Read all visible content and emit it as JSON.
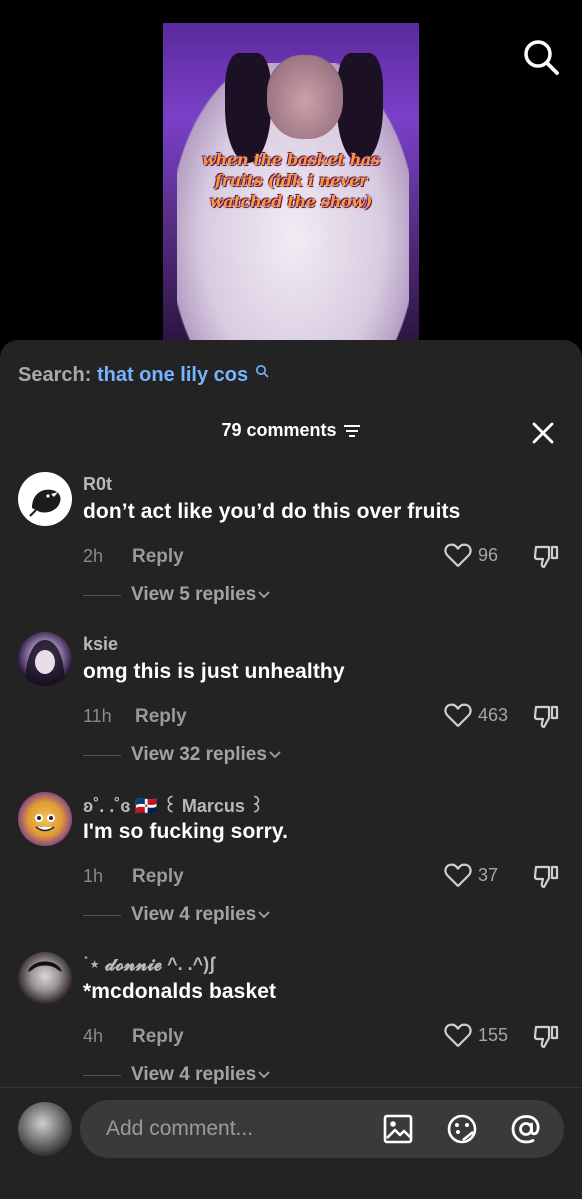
{
  "video": {
    "caption_lines": [
      "when the basket has",
      "fruits (idk i never",
      "watched the show)"
    ]
  },
  "search": {
    "label": "Search:",
    "query": "that one lily cos"
  },
  "comments_header": {
    "count_text": "79 comments"
  },
  "comments": [
    {
      "username": "R0t",
      "text": "don’t act like you’d do this over fruits",
      "time": "2h",
      "reply_label": "Reply",
      "likes": "96",
      "view_replies": "View 5 replies"
    },
    {
      "username": "ksie",
      "text": "omg this is just unhealthy",
      "time": "11h",
      "reply_label": "Reply",
      "likes": "463",
      "view_replies": "View 32 replies"
    },
    {
      "username": "ʚ˚. .˚ɞ 🇩🇴 ꒰ Marcus ꒱",
      "text": "I'm so fucking sorry.",
      "time": "1h",
      "reply_label": "Reply",
      "likes": "37",
      "view_replies": "View 4 replies"
    },
    {
      "username": "˙⋆ 𝓭𝓸𝓷𝓷𝓲𝓮 ^. .^)ʃ",
      "text": "*mcdonalds basket",
      "time": "4h",
      "reply_label": "Reply",
      "likes": "155",
      "view_replies": "View 4 replies"
    }
  ],
  "composer": {
    "placeholder": "Add comment..."
  },
  "colors": {
    "sheet_bg": "#232323",
    "search_query": "#77b3ff",
    "video_bg": "#7a40c8"
  },
  "icons": [
    "search-icon",
    "filter-icon",
    "close-icon",
    "heart-icon",
    "dislike-icon",
    "chevron-down-icon",
    "image-icon",
    "emoji-icon",
    "mention-icon"
  ]
}
